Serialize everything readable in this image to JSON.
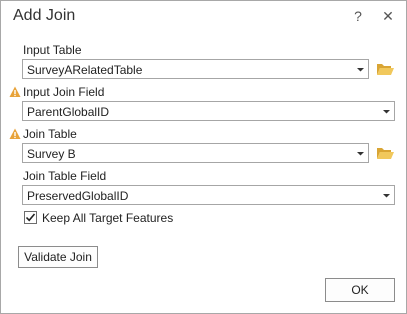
{
  "dialog": {
    "title": "Add Join",
    "help_label": "?",
    "close_label": "✕"
  },
  "input_table": {
    "label": "Input Table",
    "value": "SurveyARelatedTable"
  },
  "input_join_field": {
    "label": "Input Join Field",
    "value": "ParentGlobalID",
    "warning": true
  },
  "join_table": {
    "label": "Join Table",
    "value": "Survey B",
    "warning": true
  },
  "join_table_field": {
    "label": "Join Table Field",
    "value": "PreservedGlobalID"
  },
  "keep_all": {
    "label": "Keep All Target Features",
    "checked": true
  },
  "buttons": {
    "validate_label": "Validate Join",
    "ok_label": "OK"
  },
  "colors": {
    "warning": "#e8a33a",
    "folder": "#e6b54a"
  },
  "icons": {
    "warning": "warning-icon",
    "folder": "folder-open-icon",
    "dropdown": "chevron-down-icon",
    "check": "checkmark-icon"
  }
}
